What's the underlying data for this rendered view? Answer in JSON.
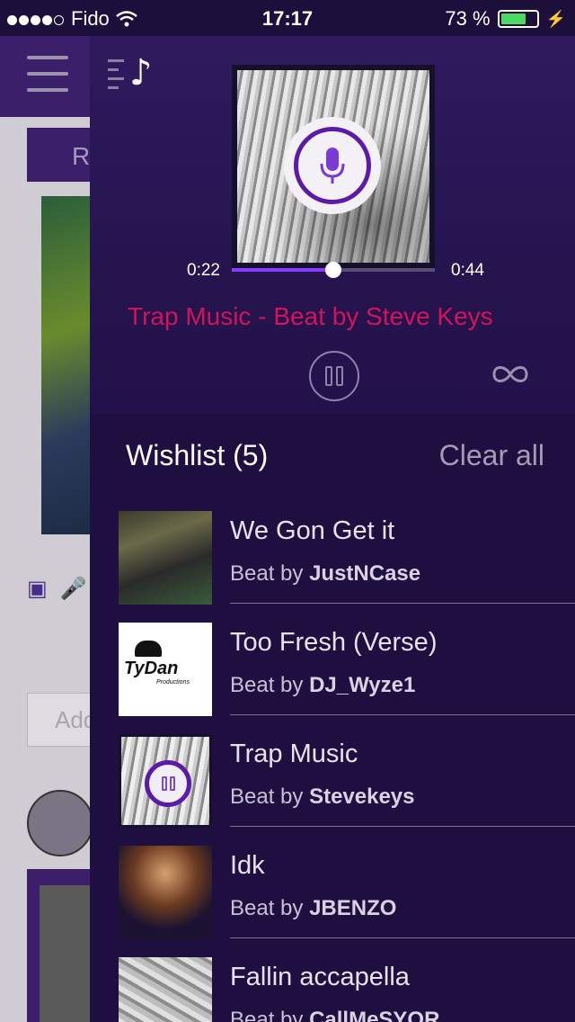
{
  "status": {
    "carrier": "Fido",
    "time": "17:17",
    "battery": "73 %",
    "signal_bars": 4
  },
  "background": {
    "tab_label": "R",
    "input_placeholder": "Add"
  },
  "player": {
    "current_time": "0:22",
    "total_time": "0:44",
    "progress": 0.5,
    "track_title": "Trap Music - Beat by Steve Keys"
  },
  "wishlist": {
    "title": "Wishlist (5)",
    "clear_label": "Clear all",
    "prefix": "Beat by ",
    "items": [
      {
        "title": "We Gon Get it",
        "artist": "JustNCase"
      },
      {
        "title": "Too Fresh (Verse)",
        "artist": "DJ_Wyze1",
        "thumb_text": "TyDan",
        "thumb_subtext": "Productions"
      },
      {
        "title": "Trap Music",
        "artist": "Stevekeys",
        "playing": true
      },
      {
        "title": "Idk",
        "artist": "JBENZO"
      },
      {
        "title": "Fallin accapella",
        "artist": "CallMeSYOR"
      }
    ]
  },
  "colors": {
    "accent": "#5b1aa8",
    "title_pink": "#d4145a",
    "drawer_bg": "#1f0f40"
  }
}
